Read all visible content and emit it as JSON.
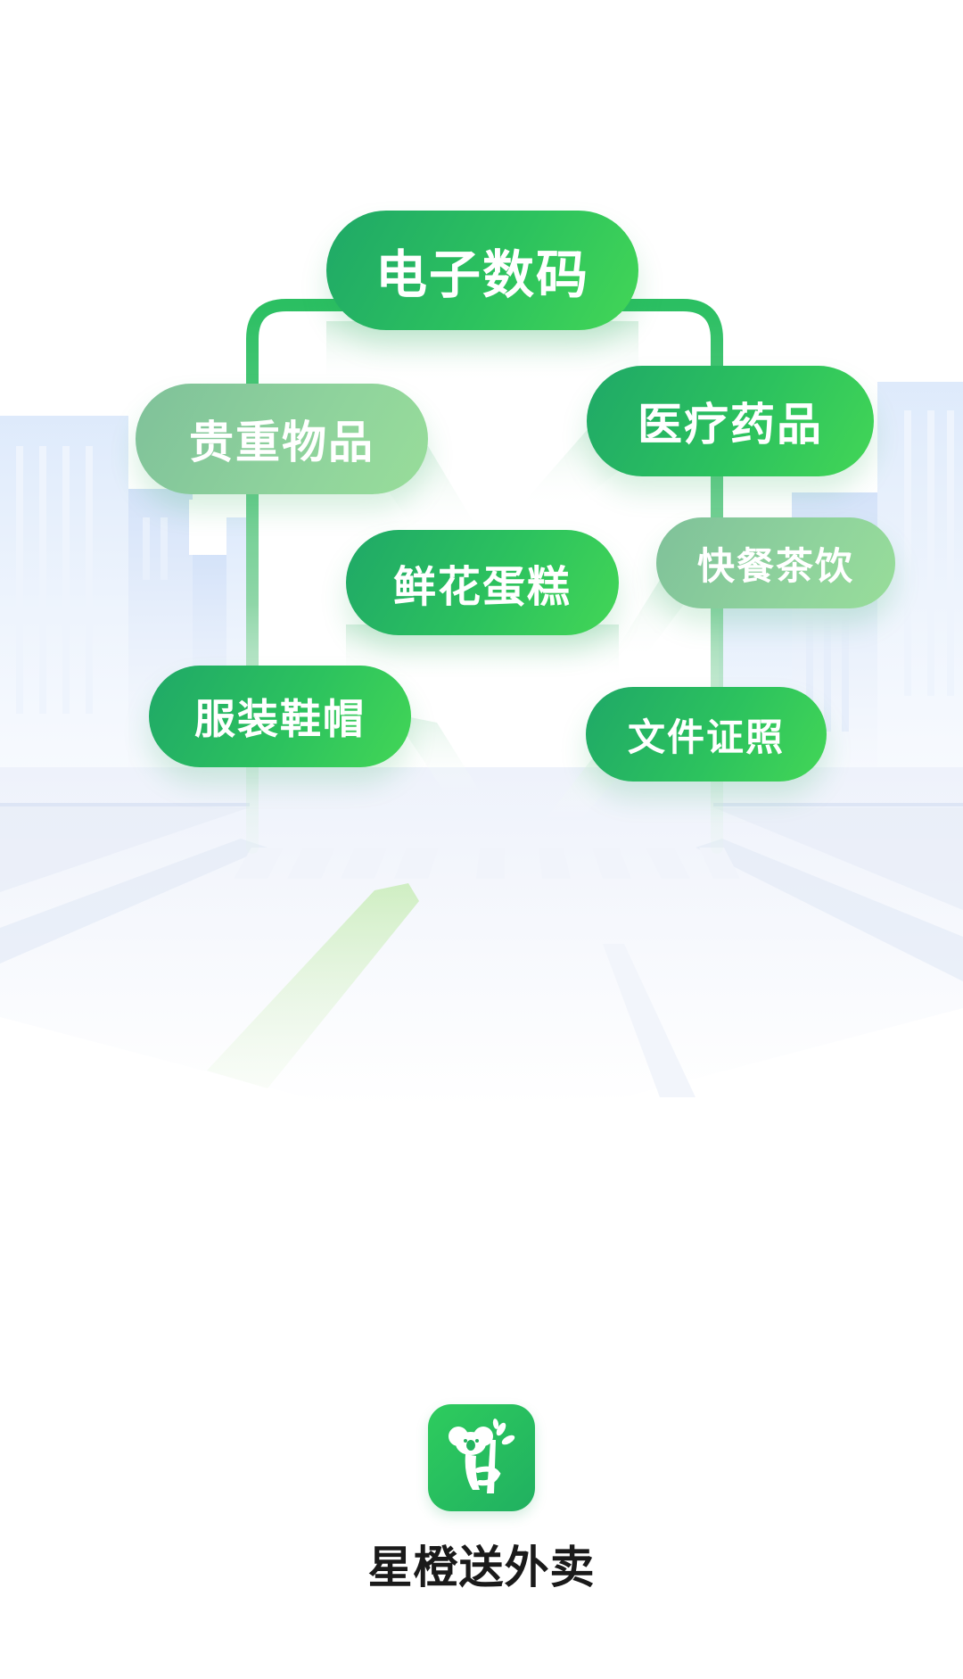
{
  "categories": {
    "electronics": "电子数码",
    "valuables": "贵重物品",
    "medicine": "医疗药品",
    "flowers_cakes": "鲜花蛋糕",
    "fast_food_drinks": "快餐茶饮",
    "apparel": "服装鞋帽",
    "documents": "文件证照"
  },
  "app": {
    "name": "星橙送外卖",
    "logo_icon": "koala-on-branch-icon"
  },
  "colors": {
    "brand_green": "#2cc25e",
    "brand_green_dark": "#1fa867",
    "soft_green": "#8fd39c",
    "building_blue": "#dbe8fb",
    "text_dark": "#1a1a1a"
  }
}
